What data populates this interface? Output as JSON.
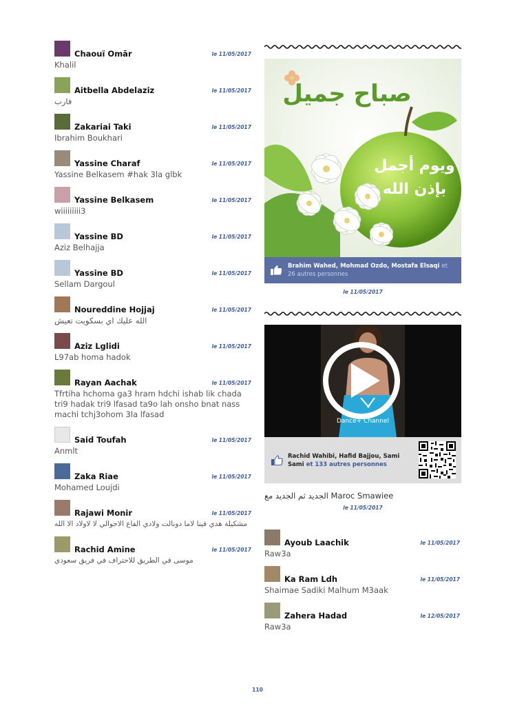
{
  "left_comments": [
    {
      "name": "Chaouï Omār",
      "date": "le 11/05/2017",
      "text": "Khalil",
      "rtl": false,
      "avatar_color": "#6a3a6a"
    },
    {
      "name": "Aitbella Abdelaziz",
      "date": "le 11/05/2017",
      "text": "فارب",
      "rtl": true,
      "avatar_color": "#8aa35a"
    },
    {
      "name": "Zakariai Taki",
      "date": "le 11/05/2017",
      "text": "Ibrahim Boukhari",
      "rtl": false,
      "avatar_color": "#5a6b3a"
    },
    {
      "name": "Yassine Charaf",
      "date": "le 11/05/2017",
      "text": "Yassine Belkasem #hak 3la glbk",
      "rtl": false,
      "avatar_color": "#9a8a7a"
    },
    {
      "name": "Yassine Belkasem",
      "date": "le 11/05/2017",
      "text": "wiiiiiiiii3",
      "rtl": false,
      "avatar_color": "#c9a0a8"
    },
    {
      "name": "Yassine BD",
      "date": "le 11/05/2017",
      "text": "Aziz Belhajja",
      "rtl": false,
      "avatar_color": "#b8c8d8"
    },
    {
      "name": "Yassine BD",
      "date": "le 11/05/2017",
      "text": "Sellam Dargoul",
      "rtl": false,
      "avatar_color": "#b8c8d8"
    },
    {
      "name": "Noureddine Hojjaj",
      "date": "le 11/05/2017",
      "text": "الله عليك اي بسكويت تعيش",
      "rtl": true,
      "avatar_color": "#a07858"
    },
    {
      "name": "Aziz Lglidi",
      "date": "le 11/05/2017",
      "text": "L97ab homa hadok",
      "rtl": false,
      "avatar_color": "#7a4a4a"
    },
    {
      "name": "Rayan Aachak",
      "date": "le 11/05/2017",
      "text": "Tfrtiha hchoma ga3 hram hdchi ishab lik chada tri9 hadak tri9 lfasad ta9o lah onsho bnat nass machi tchj3ohom 3la lfasad",
      "rtl": false,
      "avatar_color": "#6a7a3a"
    },
    {
      "name": "Said Toufah",
      "date": "le 11/05/2017",
      "text": "Anmlt",
      "rtl": false,
      "avatar_color": "#e8e8e8"
    },
    {
      "name": "Zaka Riae",
      "date": "le 11/05/2017",
      "text": "Mohamed Loujdi",
      "rtl": false,
      "avatar_color": "#4a6a9a"
    },
    {
      "name": "Rajawi Monir",
      "date": "le 11/05/2017",
      "text": "مشكيلة هدي فينا لاما دونالت ولادي الفاع الاحوالي لا لاولاد الا الله",
      "rtl": true,
      "avatar_color": "#9a7a6a"
    },
    {
      "name": "Rachid Amine",
      "date": "le 11/05/2017",
      "text": "موسى في الطريق للاحتراف في فريق سعودي",
      "rtl": true,
      "avatar_color": "#9a9a6a"
    }
  ],
  "post1": {
    "image_text_top": "صباح جميل",
    "image_text_mid": "ويوم أجمل",
    "image_text_bottom": "بإذن الله",
    "like_names": "Brahim Wahed, Mohmad Ozdo, Mostafa Elsaqi",
    "like_others": "et 26 autres personnes",
    "date": "le 11/05/2017"
  },
  "post2": {
    "video_label": "Dance+ Channel",
    "like_names": "Rachid Wahibi, Hafid Bajjou, Sami Sami",
    "like_others": "et 133 autres personnes",
    "caption": "الجديد ثم الجديد مع Maroc Smawiee",
    "date": "le 11/05/2017"
  },
  "right_comments": [
    {
      "name": "Ayoub Laachik",
      "date": "le 11/05/2017",
      "text": "Raw3a",
      "rtl": false,
      "avatar_color": "#8a7a6a"
    },
    {
      "name": "Ka Ram Ldh",
      "date": "le 11/05/2017",
      "text": "Shaimae Sadiki Malhum M3aak",
      "rtl": false,
      "avatar_color": "#a08868"
    },
    {
      "name": "Zahera Hadad",
      "date": "le 12/05/2017",
      "text": "Raw3a",
      "rtl": false,
      "avatar_color": "#9a9a7a"
    }
  ],
  "page_number": "110",
  "colors": {
    "date_blue": "#3b5a9a",
    "like_bar": "#5a6ea3",
    "video_bg": "#0c0c0c"
  }
}
